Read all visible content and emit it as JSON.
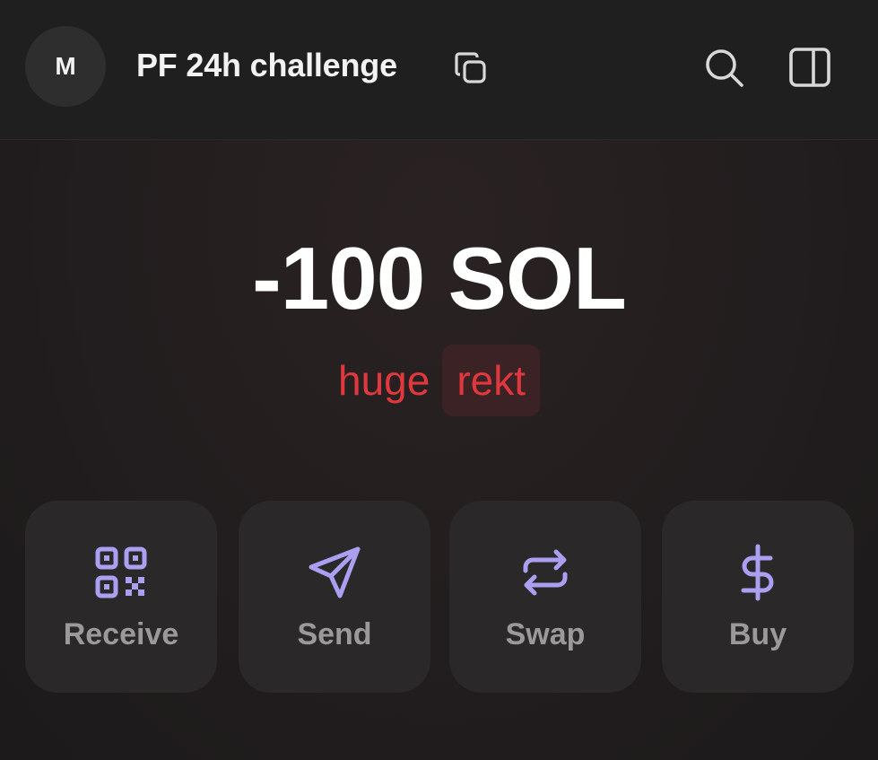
{
  "header": {
    "avatar_initial": "M",
    "wallet_name": "PF 24h challenge",
    "icons": [
      "copy-icon",
      "search-icon",
      "sidebar-panel-icon"
    ]
  },
  "balance": {
    "amount": "-100 SOL",
    "change_label": "huge",
    "change_badge": "rekt"
  },
  "actions": [
    {
      "label": "Receive",
      "icon": "qr-code-icon"
    },
    {
      "label": "Send",
      "icon": "send-icon"
    },
    {
      "label": "Swap",
      "icon": "swap-icon"
    },
    {
      "label": "Buy",
      "icon": "dollar-icon"
    }
  ],
  "colors": {
    "accent": "#ab9ff2",
    "negative": "#e0383f",
    "background": "#1e1b1c",
    "card": "#2a2828"
  }
}
